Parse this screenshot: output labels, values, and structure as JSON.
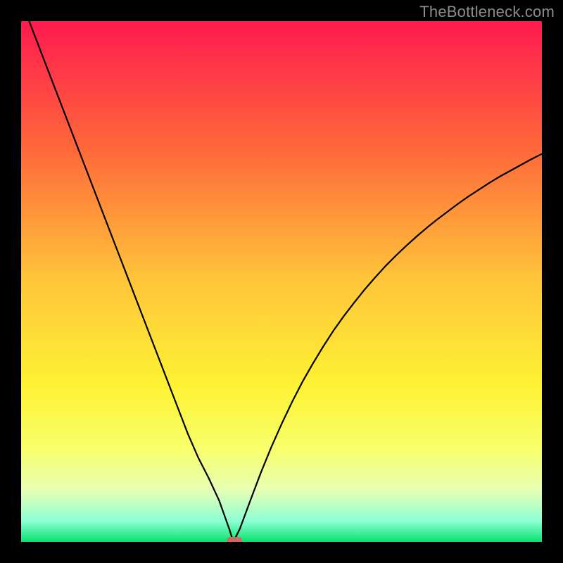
{
  "watermark": "TheBottleneck.com",
  "chart_data": {
    "type": "line",
    "title": "",
    "xlabel": "",
    "ylabel": "",
    "xlim": [
      0,
      100
    ],
    "ylim": [
      0,
      100
    ],
    "x": [
      0,
      2,
      4,
      6,
      8,
      10,
      12,
      14,
      16,
      18,
      20,
      22,
      24,
      26,
      28,
      30,
      32,
      34,
      36,
      38,
      40,
      40.5,
      41,
      42,
      44,
      46,
      48,
      50,
      52,
      54,
      56,
      58,
      60,
      62,
      64,
      66,
      68,
      70,
      72,
      74,
      76,
      78,
      80,
      82,
      84,
      86,
      88,
      90,
      92,
      94,
      96,
      98,
      100
    ],
    "values": [
      104,
      98.8,
      93.6,
      88.4,
      83.2,
      78,
      72.8,
      67.6,
      62.4,
      57.2,
      52,
      46.8,
      41.6,
      36.4,
      31.2,
      26,
      20.8,
      16.2,
      12.3,
      8.0,
      2.4,
      0.8,
      0.5,
      2.5,
      7.9,
      13.2,
      18.1,
      22.6,
      26.8,
      30.7,
      34.2,
      37.5,
      40.6,
      43.4,
      46.0,
      48.5,
      50.8,
      53.0,
      55.0,
      56.9,
      58.7,
      60.4,
      62.0,
      63.5,
      65.0,
      66.4,
      67.7,
      69.0,
      70.2,
      71.3,
      72.4,
      73.5,
      74.5
    ],
    "marker": {
      "x": 41,
      "y": 0
    },
    "gradient_stops": [
      {
        "pos": 0.0,
        "color": "#ff1a4f"
      },
      {
        "pos": 0.25,
        "color": "#ff6a3a"
      },
      {
        "pos": 0.5,
        "color": "#ffc63a"
      },
      {
        "pos": 0.7,
        "color": "#fef233"
      },
      {
        "pos": 0.82,
        "color": "#f8ff6a"
      },
      {
        "pos": 0.9,
        "color": "#e7ffb4"
      },
      {
        "pos": 0.96,
        "color": "#8dffd4"
      },
      {
        "pos": 1.0,
        "color": "#05e36b"
      }
    ]
  }
}
